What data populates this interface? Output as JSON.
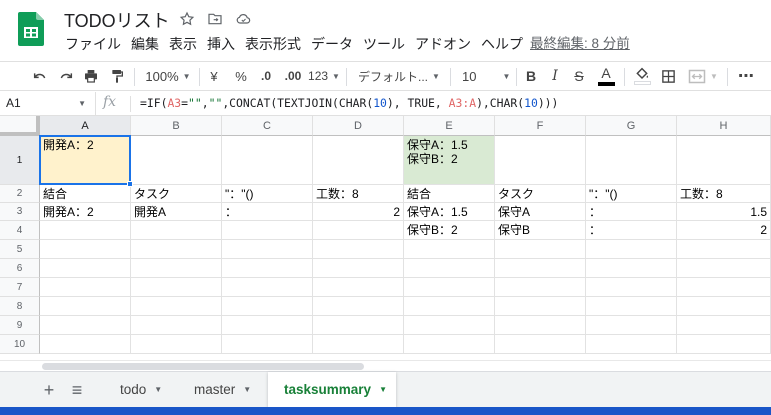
{
  "app": {
    "brand_color": "#0f9d58",
    "accent_color": "#1a73e8",
    "tab_active_color": "#188038"
  },
  "doc": {
    "title": "TODOリスト",
    "last_edit": "最終編集: 8 分前"
  },
  "title_icons": [
    "star-icon",
    "move-to-folder-icon",
    "cloud-status-icon"
  ],
  "menu": [
    "ファイル",
    "編集",
    "表示",
    "挿入",
    "表示形式",
    "データ",
    "ツール",
    "アドオン",
    "ヘルプ"
  ],
  "toolbar": {
    "zoom": "100%",
    "currency": "¥",
    "percent": "%",
    "decimal_decrease": ".0",
    "decimal_increase": ".00",
    "more_formats": "123",
    "font": "デフォルト...",
    "font_size": "10",
    "bold": "B",
    "strikethrough": "S",
    "text_color_letter": "A",
    "more": "⋯"
  },
  "formula_bar": {
    "cell_ref": "A1",
    "fx": "fx",
    "formula": {
      "p1": "=IF(",
      "ref1": "A3",
      "p2": "=",
      "str1": "\"\"",
      "p3": ",",
      "str2": "\"\"",
      "p4": ",CONCAT(TEXTJOIN(CHAR(",
      "num1": "10",
      "p5": "), TRUE, ",
      "range": "A3:A",
      "p6": "),CHAR(",
      "num2": "10",
      "p7": ")))"
    }
  },
  "columns": [
    "A",
    "B",
    "C",
    "D",
    "E",
    "F",
    "G",
    "H"
  ],
  "rows": [
    "1",
    "2",
    "3",
    "4",
    "5",
    "6",
    "7",
    "8",
    "9",
    "10"
  ],
  "cells": {
    "A1": "開発A：2",
    "E1": "保守A：1.5\n保守B：2",
    "A2": "結合",
    "B2": "タスク",
    "C2": "\"：\"()",
    "D2": "工数：8",
    "E2": "結合",
    "F2": "タスク",
    "G2": "\"：\"()",
    "H2": "工数：8",
    "A3": "開発A：2",
    "B3": "開発A",
    "C3": "：",
    "D3": "2",
    "E3": "保守A：1.5",
    "F3": "保守A",
    "G3": "：",
    "H3": "1.5",
    "E4": "保守B：2",
    "F4": "保守B",
    "G4": "：",
    "H4": "2"
  },
  "fills": {
    "A1": "#fff2cc",
    "E1": "#d9ead3"
  },
  "sheets": {
    "tabs": [
      {
        "label": "todo",
        "active": false
      },
      {
        "label": "master",
        "active": false
      },
      {
        "label": "tasksummary",
        "active": true
      }
    ],
    "add_icon": "+",
    "list_icon": "≡"
  }
}
